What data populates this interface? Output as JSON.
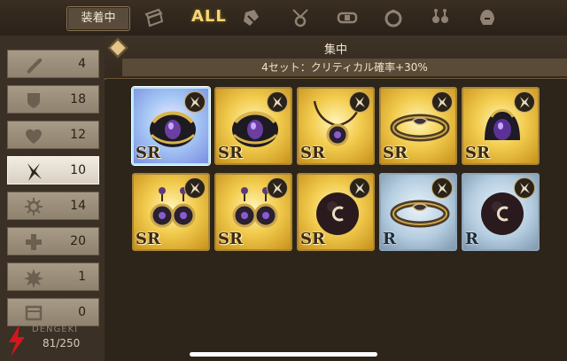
{
  "topbar": {
    "equipped_label": "装着中",
    "all_tab": "ALL",
    "category_icons": [
      "ticket-icon",
      "gauntlet-icon",
      "pendant-icon",
      "belt-icon",
      "ring-icon",
      "earring-icon",
      "helm-icon"
    ]
  },
  "filters": [
    {
      "icon": "sword-icon",
      "count": "4"
    },
    {
      "icon": "shield-icon",
      "count": "18"
    },
    {
      "icon": "heart-icon",
      "count": "12"
    },
    {
      "icon": "critical-icon",
      "count": "10",
      "active": true
    },
    {
      "icon": "burst-icon",
      "count": "14"
    },
    {
      "icon": "cross-icon",
      "count": "20"
    },
    {
      "icon": "starburst-icon",
      "count": "1"
    },
    {
      "icon": "box-icon",
      "count": "0"
    }
  ],
  "inventory": {
    "count": "81/250"
  },
  "watermark": {
    "text": "DENGEKI"
  },
  "set": {
    "name": "集中",
    "effect": "4セット：クリティカル確率+30%"
  },
  "items": [
    {
      "type": "gauntlet",
      "rarity": "SR",
      "selected": true
    },
    {
      "type": "gauntlet",
      "rarity": "SR"
    },
    {
      "type": "pendant",
      "rarity": "SR"
    },
    {
      "type": "belt",
      "rarity": "SR"
    },
    {
      "type": "helm",
      "rarity": "SR"
    },
    {
      "type": "earring",
      "rarity": "SR"
    },
    {
      "type": "earring",
      "rarity": "SR"
    },
    {
      "type": "orb",
      "rarity": "SR"
    },
    {
      "type": "belt",
      "rarity": "R"
    },
    {
      "type": "orb",
      "rarity": "R"
    }
  ],
  "colors": {
    "gold": "#f2cc4e",
    "rare_blue": "#b5cde0",
    "selected": "#a7c8f5",
    "accent": "#f4d677"
  }
}
